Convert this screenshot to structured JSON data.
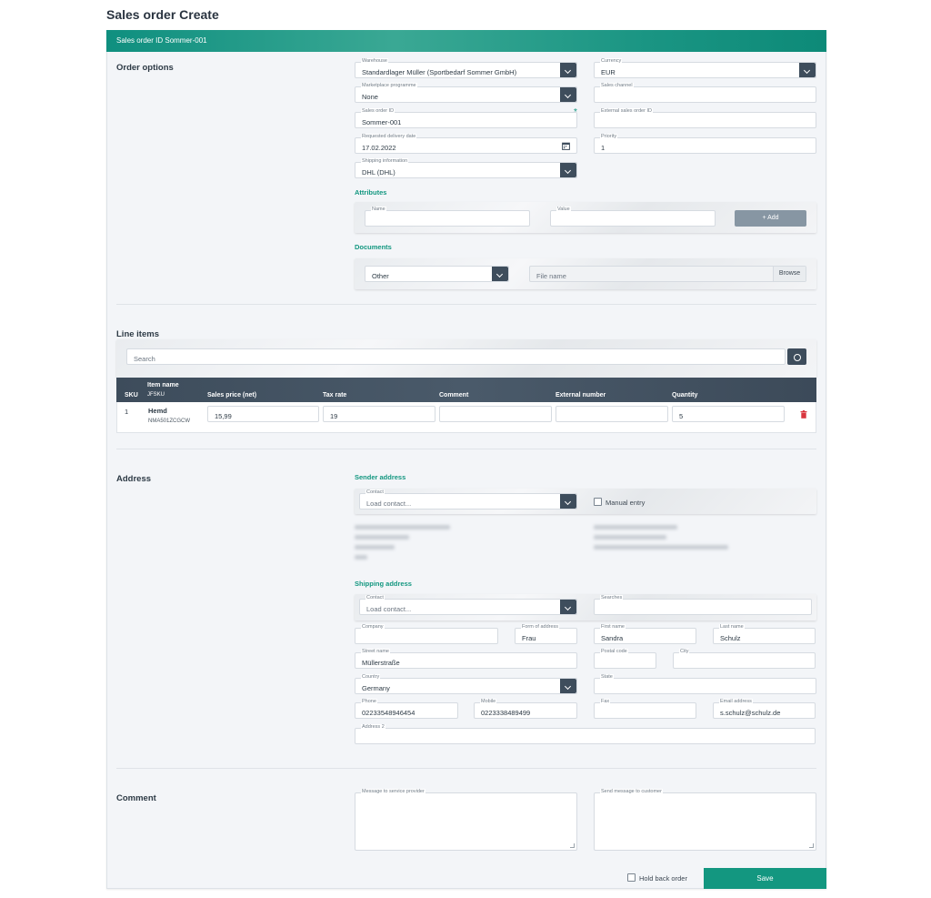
{
  "page_title": "Sales order Create",
  "card_header": "Sales order ID Sommer-001",
  "order_options": {
    "title": "Order options",
    "warehouse": {
      "label": "Warehouse",
      "value": "Standardlager Müller (Sportbedarf Sommer GmbH)"
    },
    "currency": {
      "label": "Currency",
      "value": "EUR"
    },
    "marketplace": {
      "label": "Marketplace programme",
      "value": "None"
    },
    "sales_channel": {
      "label": "Sales channel",
      "value": ""
    },
    "sales_order_id": {
      "label": "Sales order ID",
      "value": "Sommer-001",
      "required_mark": "*"
    },
    "external_id": {
      "label": "External sales order ID",
      "value": ""
    },
    "delivery_date": {
      "label": "Requested delivery date",
      "value": "17.02.2022"
    },
    "priority": {
      "label": "Priority",
      "value": "1"
    },
    "shipping_info": {
      "label": "Shipping information",
      "value": "DHL (DHL)"
    }
  },
  "attributes": {
    "title": "Attributes",
    "name_label": "Name",
    "value_label": "Value",
    "add_label": "+ Add"
  },
  "documents": {
    "title": "Documents",
    "type_value": "Other",
    "file_placeholder": "File name",
    "browse_label": "Browse"
  },
  "line_items": {
    "title": "Line items",
    "search_placeholder": "Search",
    "columns": {
      "sku": "SKU",
      "item_name": "Item name",
      "jfsku": "JFSKU",
      "sales_price": "Sales price (net)",
      "tax_rate": "Tax rate",
      "comment": "Comment",
      "external_number": "External number",
      "quantity": "Quantity"
    },
    "rows": [
      {
        "sku": "1",
        "name": "Hemd",
        "jfsku": "NMA501ZCGCW",
        "price": "15,99",
        "tax": "19",
        "comment": "",
        "external": "",
        "quantity": "5"
      }
    ]
  },
  "address": {
    "title": "Address",
    "sender": {
      "title": "Sender address",
      "contact_label": "Contact",
      "contact_placeholder": "Load contact...",
      "manual_entry": "Manual entry"
    },
    "shipping": {
      "title": "Shipping address",
      "contact_label": "Contact",
      "contact_placeholder": "Load contact...",
      "searches_label": "Searches",
      "company": {
        "label": "Company",
        "value": ""
      },
      "form_of_address": {
        "label": "Form of address",
        "value": "Frau"
      },
      "first_name": {
        "label": "First name",
        "value": "Sandra"
      },
      "last_name": {
        "label": "Last name",
        "value": "Schulz"
      },
      "street": {
        "label": "Street name",
        "value": "Müllerstraße"
      },
      "postal_code": {
        "label": "Postal code",
        "value": ""
      },
      "city": {
        "label": "City",
        "value": ""
      },
      "country": {
        "label": "Country",
        "value": "Germany"
      },
      "state": {
        "label": "State",
        "value": ""
      },
      "phone": {
        "label": "Phone",
        "value": "02233548946454"
      },
      "mobile": {
        "label": "Mobile",
        "value": "0223338489499"
      },
      "fax": {
        "label": "Fax",
        "value": ""
      },
      "email": {
        "label": "Email address",
        "value": "s.schulz@schulz.de"
      },
      "address2": {
        "label": "Address 2",
        "value": ""
      }
    }
  },
  "comment": {
    "title": "Comment",
    "provider_label": "Message to service provider",
    "customer_label": "Send message to customer"
  },
  "footer": {
    "hold_back": "Hold back order",
    "save": "Save"
  },
  "colors": {
    "accent": "#139780",
    "dark": "#3e4d5c",
    "delete": "#d9363e"
  }
}
